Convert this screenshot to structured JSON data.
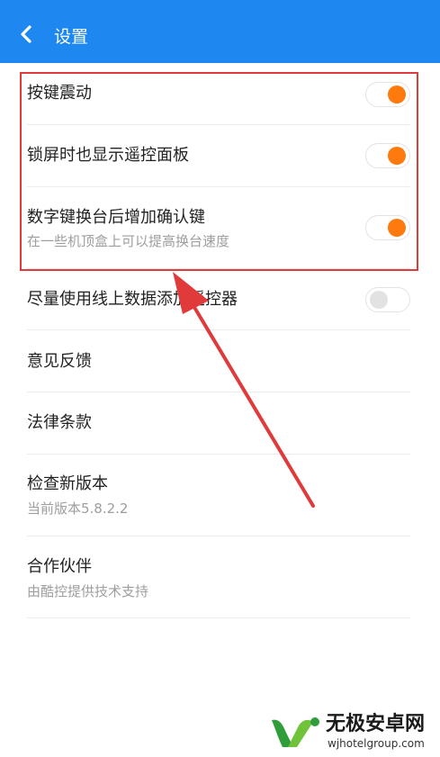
{
  "appbar": {
    "title": "设置",
    "back_icon": "chevron-left-icon",
    "color": "#1e88f0"
  },
  "settings": [
    {
      "label": "按键震动",
      "toggle": true
    },
    {
      "label": "锁屏时也显示遥控面板",
      "toggle": true
    },
    {
      "label": "数字键换台后增加确认键",
      "sub": "在一些机顶盒上可以提高换台速度",
      "toggle": true
    },
    {
      "label": "尽量使用线上数据添加遥控器",
      "toggle": false
    },
    {
      "label": "意见反馈"
    },
    {
      "label": "法律条款"
    },
    {
      "label": "检查新版本",
      "sub": "当前版本5.8.2.2"
    },
    {
      "label": "合作伙伴",
      "sub": "由酷控提供技术支持"
    }
  ],
  "colors": {
    "toggle_on": "#ff7a0d",
    "toggle_off": "#e2e2e2",
    "annotation": "#e03a3a"
  },
  "watermark": {
    "name": "无极安卓网",
    "url": "wjhotelgroup.com"
  }
}
